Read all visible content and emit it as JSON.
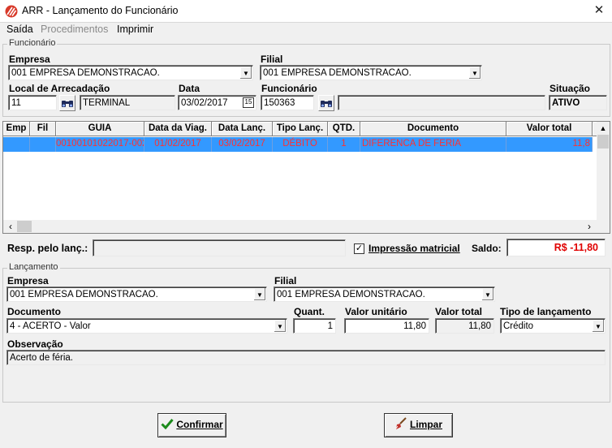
{
  "window": {
    "title": "ARR - Lançamento do Funcionário",
    "close_symbol": "✕"
  },
  "menu": {
    "saida": "Saída",
    "procedimentos": "Procedimentos",
    "imprimir": "Imprimir"
  },
  "funcionario_group": {
    "title": "Funcionário",
    "empresa": {
      "label": "Empresa",
      "value": "001 EMPRESA DEMONSTRACAO."
    },
    "filial": {
      "label": "Filial",
      "value": "001 EMPRESA DEMONSTRACAO."
    },
    "local": {
      "label": "Local de Arrecadação",
      "code": "11",
      "name": "TERMINAL"
    },
    "data": {
      "label": "Data",
      "value": "03/02/2017",
      "calendar_text": "15"
    },
    "funcionario": {
      "label": "Funcionário",
      "code": "150363",
      "name": ""
    },
    "situacao": {
      "label": "Situação",
      "value": "ATIVO"
    }
  },
  "grid": {
    "headers": [
      "Emp",
      "Fil",
      "GUIA",
      "Data da Viag.",
      "Data Lanç.",
      "Tipo Lanç.",
      "QTD.",
      "Documento",
      "Valor total"
    ],
    "rows": [
      {
        "emp": "",
        "fil": "",
        "guia": "00100101022017-002",
        "data_viag": "01/02/2017",
        "data_lanc": "03/02/2017",
        "tipo": "DÉBITO",
        "qtd": "1",
        "documento": "DIFERENCA DE FERIA",
        "valor": "11,8"
      }
    ]
  },
  "resp": {
    "label": "Resp. pelo lanç.:",
    "value": ""
  },
  "impressao": {
    "label": "Impressão matricial",
    "checked": true,
    "mark": "✓"
  },
  "saldo": {
    "label": "Saldo:",
    "value": "R$ -11,80"
  },
  "lancamento_group": {
    "title": "Lançamento",
    "empresa": {
      "label": "Empresa",
      "value": "001 EMPRESA DEMONSTRACAO."
    },
    "filial": {
      "label": "Filial",
      "value": "001 EMPRESA DEMONSTRACAO."
    },
    "documento": {
      "label": "Documento",
      "value": "4   - ACERTO - Valor"
    },
    "quant": {
      "label": "Quant.",
      "value": "1"
    },
    "valor_unitario": {
      "label": "Valor unitário",
      "value": "11,80"
    },
    "valor_total": {
      "label": "Valor total",
      "value": "11,80"
    },
    "tipo": {
      "label": "Tipo de lançamento",
      "value": "Crédito"
    },
    "observacao": {
      "label": "Observação",
      "value": "Acerto de féria."
    }
  },
  "buttons": {
    "confirmar": "Confirmar",
    "limpar": "Limpar"
  },
  "colors": {
    "selection": "#3399ff",
    "grid_text": "#ff3030",
    "saldo": "#e00000",
    "check": "#1a8a1a"
  }
}
